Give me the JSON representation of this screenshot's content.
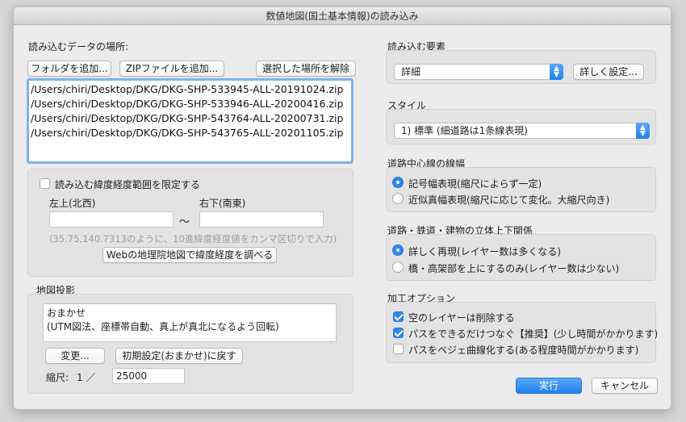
{
  "window": {
    "title": "数値地図(国土基本情報)の読み込み"
  },
  "location": {
    "heading": "読み込むデータの場所:",
    "add_folder_label": "フォルダを追加...",
    "add_zip_label": "ZIPファイルを追加...",
    "remove_label": "選択した場所を解除",
    "files": [
      "/Users/chiri/Desktop/DKG/DKG-SHP-533945-ALL-20191024.zip",
      "/Users/chiri/Desktop/DKG/DKG-SHP-533946-ALL-20200416.zip",
      "/Users/chiri/Desktop/DKG/DKG-SHP-543764-ALL-20200731.zip",
      "/Users/chiri/Desktop/DKG/DKG-SHP-543765-ALL-20201105.zip"
    ]
  },
  "range": {
    "checkbox_label": "読み込む緯度経度範囲を限定する",
    "checked": false,
    "top_left_label": "左上(北西)",
    "bottom_right_label": "右下(南東)",
    "separator": "〜",
    "top_left_value": "",
    "bottom_right_value": "",
    "hint": "(35.75,140.7313のように、10進緯度経度値をカンマ区切りで入力)",
    "web_button_label": "Webの地理院地図で緯度経度を調べる"
  },
  "projection": {
    "heading": "地図投影",
    "line1": "おまかせ",
    "line2": "(UTM図法、座標帯自動、真上が真北になるよう回転)",
    "change_label": "変更...",
    "reset_label": "初期設定(おまかせ)に戻す",
    "scale_label": "縮尺:",
    "scale_prefix": "1 ／",
    "scale_value": "25000"
  },
  "elements": {
    "heading": "読み込む要素",
    "selected": "詳細",
    "detail_button_label": "詳しく設定..."
  },
  "style": {
    "heading": "スタイル",
    "selected": "1) 標準 (細道路は1条線表現)"
  },
  "road_width": {
    "heading": "道路中心線の線幅",
    "options": [
      {
        "label": "記号幅表現(縮尺によらず一定)",
        "selected": true
      },
      {
        "label": "近似真幅表現(縮尺に応じて変化。大縮尺向き)",
        "selected": false
      }
    ]
  },
  "layering": {
    "heading": "道路・鉄道・建物の立体上下関係",
    "options": [
      {
        "label": "詳しく再現(レイヤー数は多くなる)",
        "selected": true
      },
      {
        "label": "橋・高架部を上にするのみ(レイヤー数は少ない)",
        "selected": false
      }
    ]
  },
  "processing": {
    "heading": "加工オプション",
    "options": [
      {
        "label": "空のレイヤーは削除する",
        "checked": true
      },
      {
        "label": "パスをできるだけつなぐ【推奨】(少し時間がかかります)",
        "checked": true
      },
      {
        "label": "パスをベジェ曲線化する(ある程度時間がかかります)",
        "checked": false
      }
    ]
  },
  "footer": {
    "run_label": "実行",
    "cancel_label": "キャンセル"
  },
  "colors": {
    "accent": "#1f7ff0",
    "focus_ring": "#7fb2ec",
    "window_bg": "#ececec",
    "group_bg": "#e3e3e3"
  }
}
